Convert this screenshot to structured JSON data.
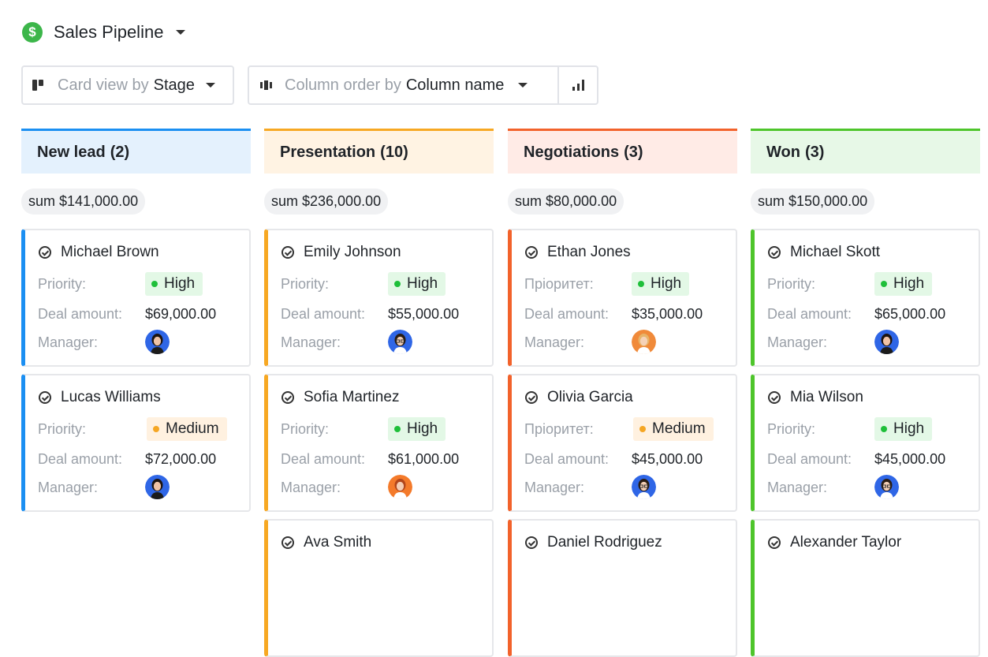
{
  "app": {
    "title": "Sales Pipeline",
    "logo_symbol": "$",
    "logo_color": "#3cb64a"
  },
  "toolbar": {
    "card_view_prefix": "Card view by",
    "card_view_value": "Stage",
    "column_order_prefix": "Column order by",
    "column_order_value": "Column name",
    "chart_icon": "bar-chart-icon"
  },
  "colors": {
    "high_dot": "#1fbf3a",
    "high_bg": "#e3f8e6",
    "medium_dot": "#f5a623",
    "medium_bg": "#fff1e0"
  },
  "columns": [
    {
      "name": "New lead",
      "count": "(2)",
      "sum": "sum $141,000.00",
      "accent": "#1b8ff2",
      "head_bg": "#e4f1fd",
      "cards": [
        {
          "name": "Michael Brown",
          "priority_label": "Priority:",
          "priority": "High",
          "amount_label": "Deal amount:",
          "amount": "$69,000.00",
          "manager_label": "Manager:",
          "avatar": "woman-dark-hair"
        },
        {
          "name": "Lucas Williams",
          "priority_label": "Priority:",
          "priority": "Medium",
          "amount_label": "Deal amount:",
          "amount": "$72,000.00",
          "manager_label": "Manager:",
          "avatar": "woman-dark-hair"
        }
      ]
    },
    {
      "name": "Presentation",
      "count": "(10)",
      "sum": "sum $236,000.00",
      "accent": "#f7a823",
      "head_bg": "#fff3e3",
      "cards": [
        {
          "name": "Emily Johnson",
          "priority_label": "Priority:",
          "priority": "High",
          "amount_label": "Deal amount:",
          "amount": "$55,000.00",
          "manager_label": "Manager:",
          "avatar": "man-glasses"
        },
        {
          "name": "Sofia Martinez",
          "priority_label": "Priority:",
          "priority": "High",
          "amount_label": "Deal amount:",
          "amount": "$61,000.00",
          "manager_label": "Manager:",
          "avatar": "woman-orange"
        },
        {
          "name": "Ava Smith"
        }
      ]
    },
    {
      "name": "Negotiations",
      "count": "(3)",
      "sum": "sum $80,000.00",
      "accent": "#f2622b",
      "head_bg": "#ffebe6",
      "cards": [
        {
          "name": "Ethan Jones",
          "priority_label": "Пріоритет:",
          "priority": "High",
          "amount_label": "Deal amount:",
          "amount": "$35,000.00",
          "manager_label": "Manager:",
          "avatar": "woman-blonde"
        },
        {
          "name": "Olivia Garcia",
          "priority_label": "Пріоритет:",
          "priority": "Medium",
          "amount_label": "Deal amount:",
          "amount": "$45,000.00",
          "manager_label": "Manager:",
          "avatar": "man-glasses"
        },
        {
          "name": "Daniel Rodriguez"
        }
      ]
    },
    {
      "name": "Won",
      "count": "(3)",
      "sum": "sum $150,000.00",
      "accent": "#4ec52b",
      "head_bg": "#e7f8e7",
      "cards": [
        {
          "name": "Michael Skott",
          "priority_label": "Priority:",
          "priority": "High",
          "amount_label": "Deal amount:",
          "amount": "$65,000.00",
          "manager_label": "Manager:",
          "avatar": "woman-dark-hair"
        },
        {
          "name": "Mia Wilson",
          "priority_label": "Priority:",
          "priority": "High",
          "amount_label": "Deal amount:",
          "amount": "$45,000.00",
          "manager_label": "Manager:",
          "avatar": "man-glasses"
        },
        {
          "name": "Alexander Taylor"
        }
      ]
    }
  ]
}
